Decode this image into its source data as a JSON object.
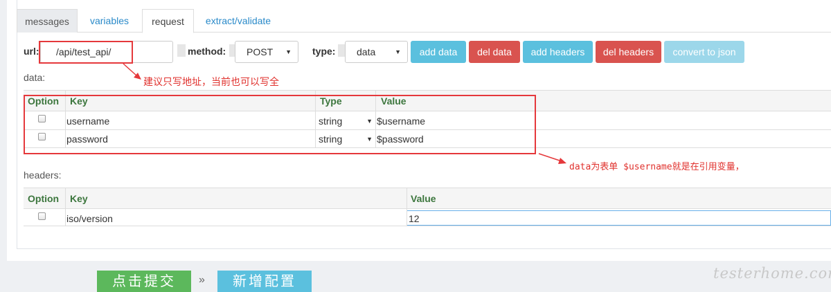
{
  "tabs": [
    "messages",
    "variables",
    "request",
    "extract/validate"
  ],
  "request": {
    "url_label": "url:",
    "url_value": "/api/test_api/",
    "method_label": "method:",
    "method_value": "POST",
    "type_label": "type:",
    "type_value": "data",
    "buttons": [
      "add data",
      "del data",
      "add headers",
      "del headers",
      "convert to json"
    ]
  },
  "annotations": {
    "url_note": "建议只写地址，当前也可以写全",
    "data_note": "data为表单 $username就是在引用变量，"
  },
  "data_section": {
    "label": "data:",
    "columns": [
      "Option",
      "Key",
      "Type",
      "Value"
    ],
    "rows": [
      {
        "key": "username",
        "type": "string",
        "value": "$username"
      },
      {
        "key": "password",
        "type": "string",
        "value": "$password"
      }
    ]
  },
  "headers_section": {
    "label": "headers:",
    "columns": [
      "Option",
      "Key",
      "Value"
    ],
    "rows": [
      {
        "key": "iso/version",
        "value": "12"
      }
    ]
  },
  "footer": {
    "submit_label": "点击提交",
    "separator": "»",
    "add_config_label": "新增配置",
    "watermark": "testerhome.com"
  },
  "colors": {
    "info": "#5bc0de",
    "danger": "#d9534f",
    "success": "#5cb85c",
    "link": "#2a8ac9",
    "header_text": "#3c763d",
    "annotation": "#e5383b"
  }
}
